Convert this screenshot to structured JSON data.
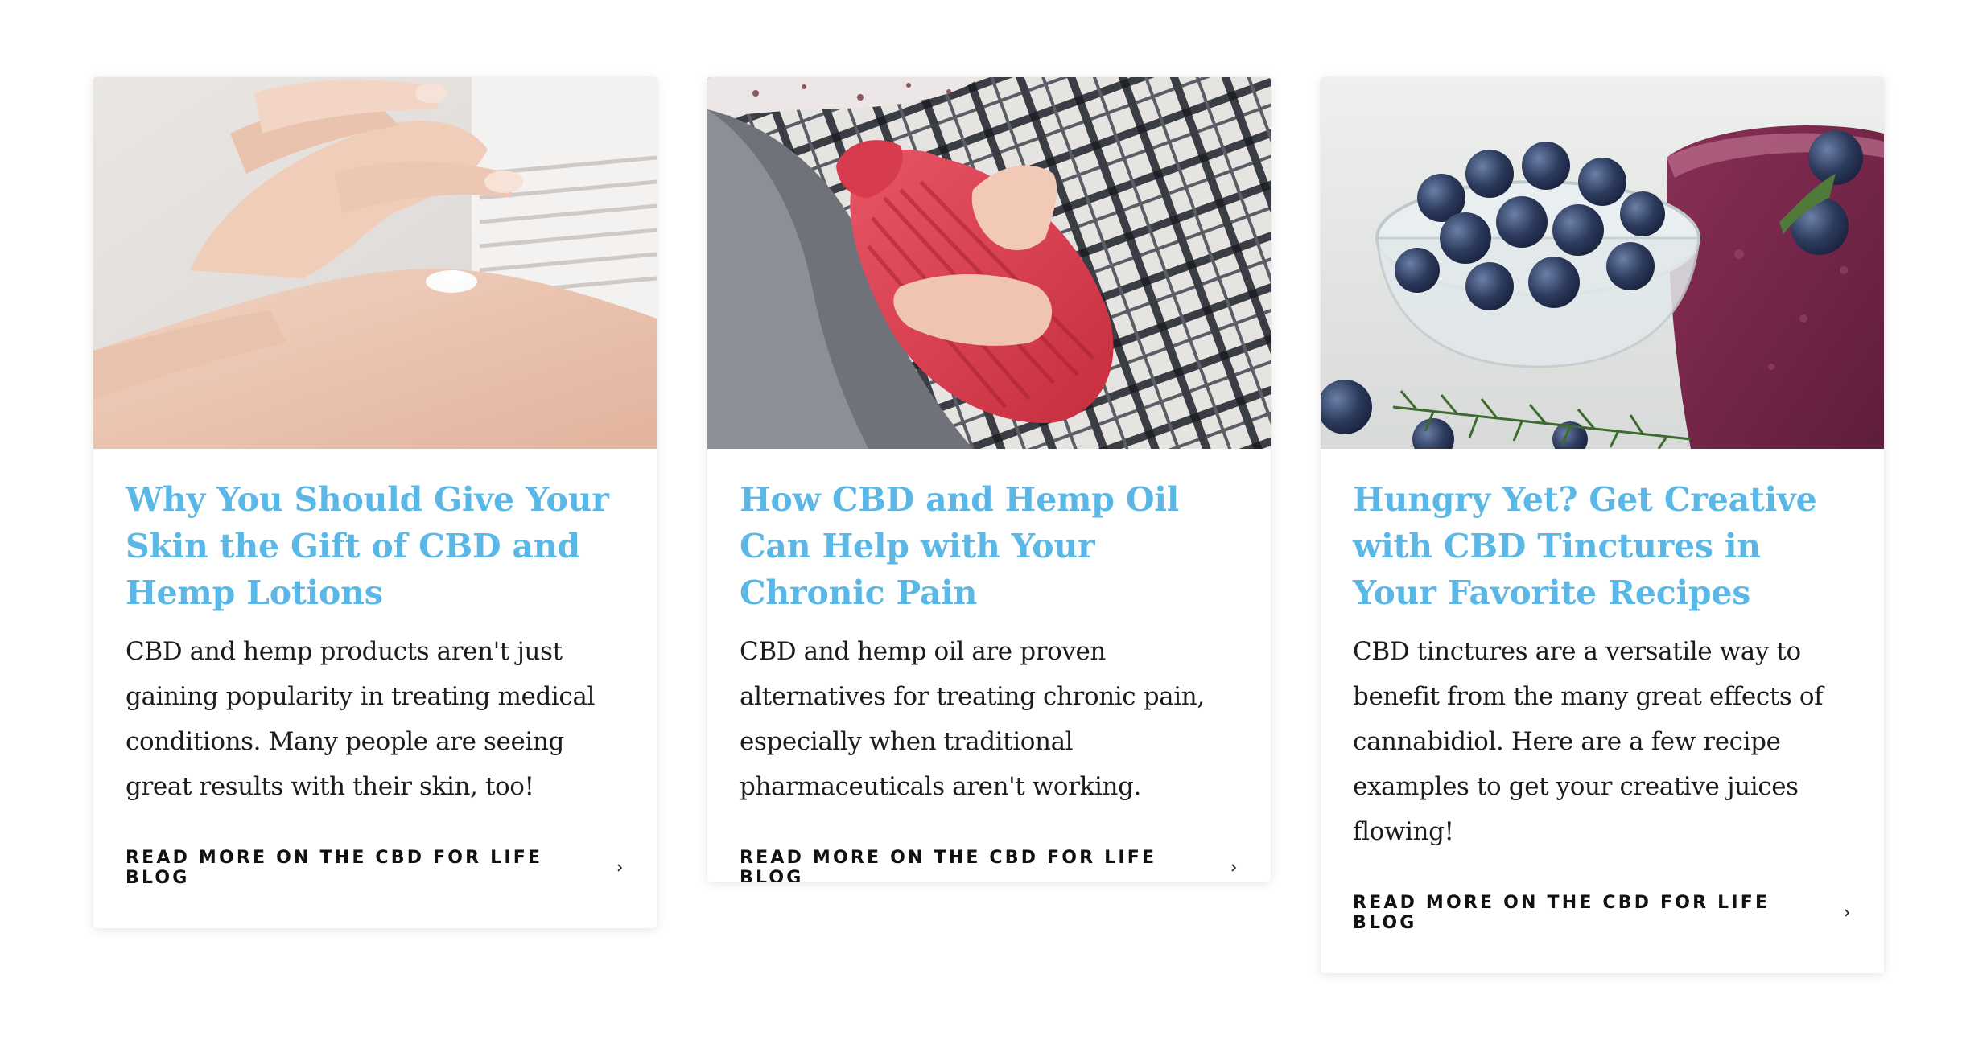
{
  "cards": [
    {
      "title": "Why You Should Give Your Skin the Gift of CBD and Hemp Lotions",
      "excerpt": "CBD and hemp products aren't just gaining popularity in treating medical conditions. Many people are seeing great results with their skin, too!",
      "link_label": "READ MORE ON THE CBD FOR LIFE BLOG",
      "image_subject": "hands applying lotion"
    },
    {
      "title": "How CBD and Hemp Oil Can Help with Your Chronic Pain",
      "excerpt": "CBD and hemp oil are proven alternatives for treating chronic pain, especially when traditional pharmaceuticals aren't working.",
      "link_label": "READ MORE ON THE CBD FOR LIFE BLOG",
      "image_subject": "person holding red hot water bottle"
    },
    {
      "title": "Hungry Yet? Get Creative with CBD Tinctures in Your Favorite Recipes",
      "excerpt": "CBD tinctures are a versatile way to benefit from the many great effects of cannabidiol. Here are a few recipe examples to get your creative juices flowing!",
      "link_label": "READ MORE ON THE CBD FOR LIFE BLOG",
      "image_subject": "blueberries and berry smoothie"
    }
  ],
  "colors": {
    "title": "#5bb8e6",
    "text": "#1c1c1c",
    "link": "#111111"
  },
  "icons": {
    "link_arrow": "chevron-right-icon"
  }
}
